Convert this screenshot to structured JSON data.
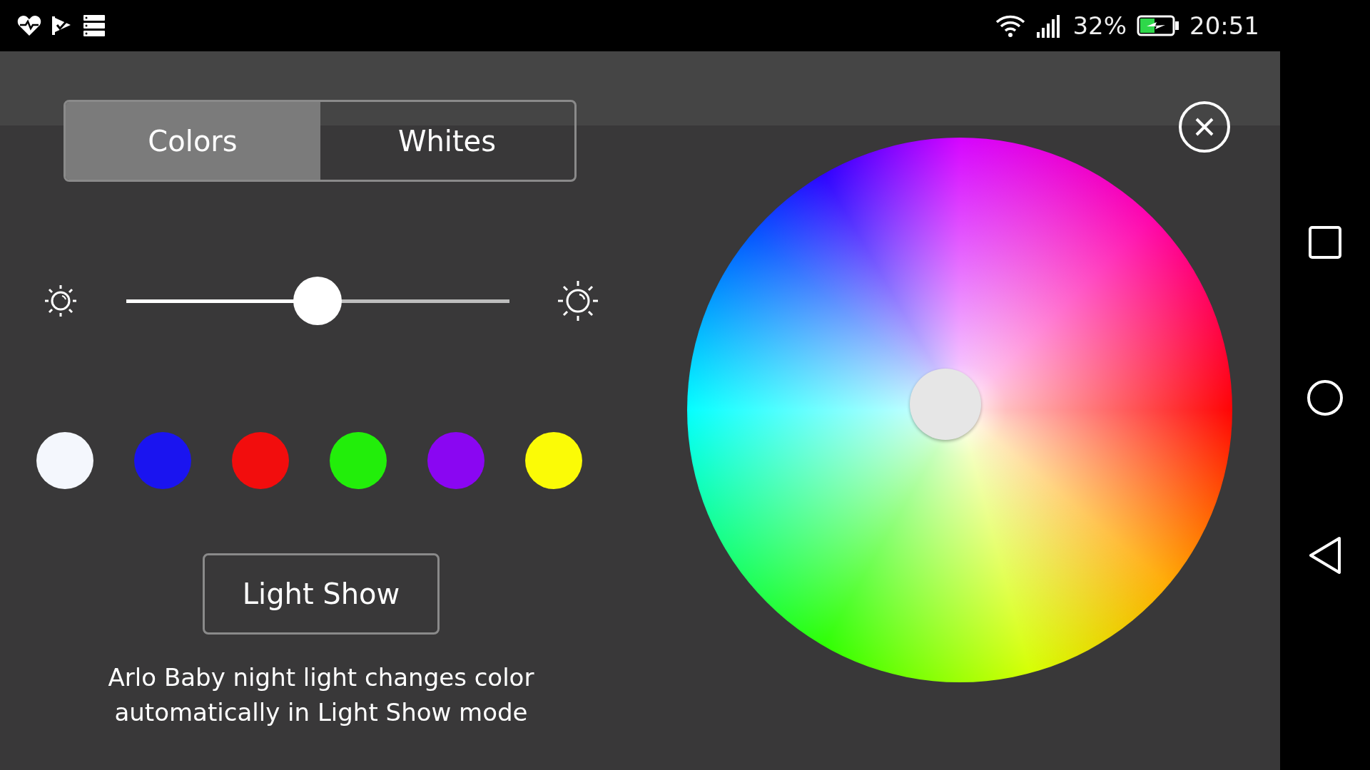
{
  "status_bar": {
    "battery": "32%",
    "time": "20:51"
  },
  "tabs": [
    {
      "label": "Colors",
      "selected": true
    },
    {
      "label": "Whites",
      "selected": false
    }
  ],
  "brightness": {
    "level": 0.5
  },
  "swatches": [
    {
      "color": "#f4f7fd"
    },
    {
      "color": "#1a14f0"
    },
    {
      "color": "#f20d0d"
    },
    {
      "color": "#22ee0a"
    },
    {
      "color": "#8a06f2"
    },
    {
      "color": "#fbfb06"
    }
  ],
  "light_show_button": "Light Show",
  "description": "Arlo Baby night light changes color automatically in Light Show mode"
}
